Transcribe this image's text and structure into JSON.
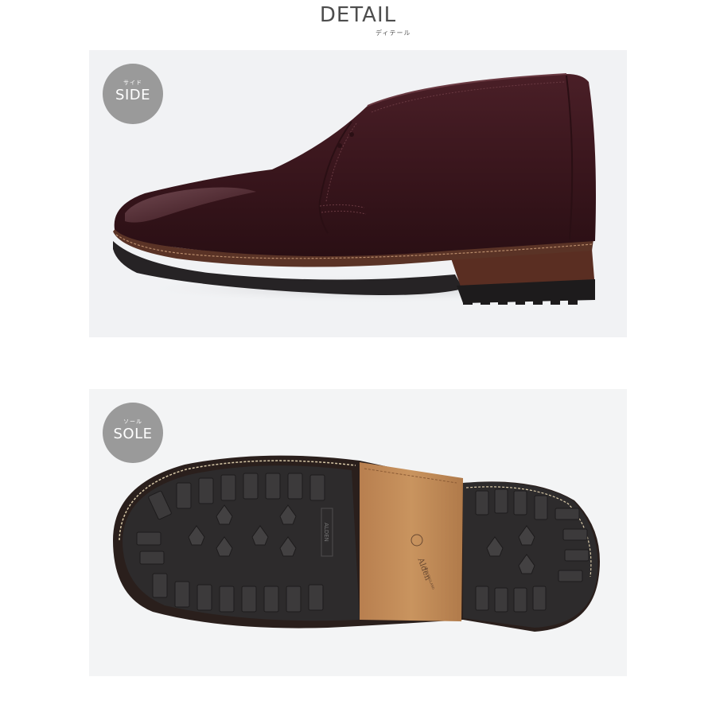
{
  "header": {
    "title": "DETAIL",
    "subtitle": "ディテール"
  },
  "sections": [
    {
      "badge_sub": "サイド",
      "badge_main": "SIDE"
    },
    {
      "badge_sub": "ソール",
      "badge_main": "SOLE"
    }
  ],
  "sole_stamps": {
    "brand_small": "ALDEN",
    "brand_script": "Alden",
    "brand_sub": "NEW ENGLAND"
  },
  "colors": {
    "leather": "#3a161d",
    "welt": "#5a3326",
    "outsole_rubber": "#2c2a2b",
    "shank_leather": "#c48c5b",
    "badge": "#9a9a9a"
  }
}
